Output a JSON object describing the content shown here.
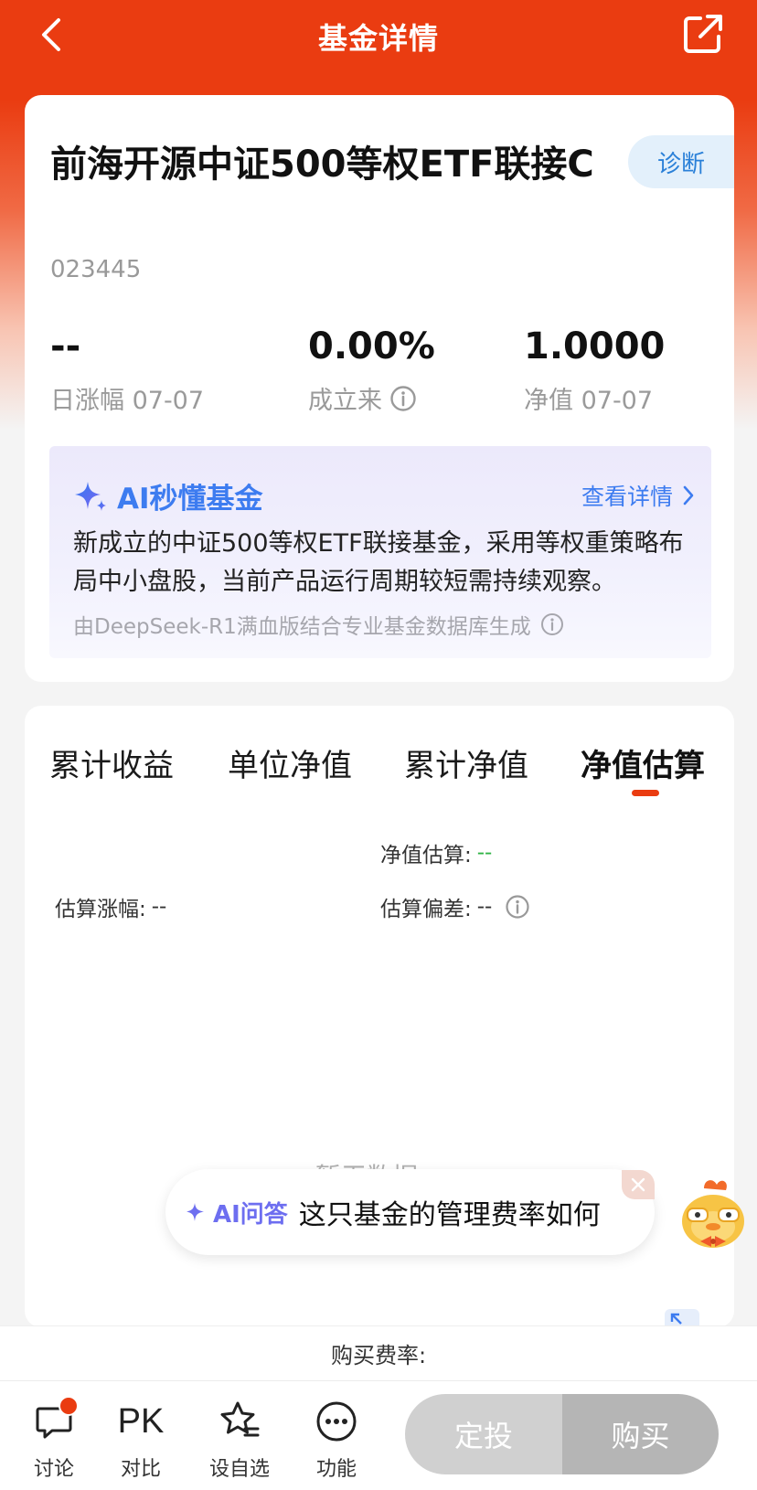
{
  "nav": {
    "title": "基金详情"
  },
  "fund": {
    "name": "前海开源中证500等权ETF联接C",
    "code": "023445",
    "diagnose_label": "诊断",
    "stats": [
      {
        "value": "--",
        "label": "日涨幅 07-07"
      },
      {
        "value": "0.00%",
        "label": "成立来"
      },
      {
        "value": "1.0000",
        "label": "净值 07-07"
      }
    ]
  },
  "ai_summary": {
    "title": "AI秒懂基金",
    "more_label": "查看详情",
    "description": "新成立的中证500等权ETF联接基金，采用等权重策略布局中小盘股，当前产品运行周期较短需持续观察。",
    "source": "由DeepSeek-R1满血版结合专业基金数据库生成"
  },
  "chart_tabs": {
    "tabs": [
      "累计收益",
      "单位净值",
      "累计净值",
      "净值估算"
    ],
    "active_index": 3
  },
  "estimate": {
    "nav_label": "净值估算:",
    "nav_value": "--",
    "change_label": "估算涨幅:",
    "change_value": "--",
    "deviation_label": "估算偏差:",
    "deviation_value": "--",
    "no_data": "暂无数据"
  },
  "ai_ask": {
    "tag": "AI问答",
    "question": "这只基金的管理费率如何"
  },
  "fee_bar": {
    "label": "购买费率:"
  },
  "bottom_bar": {
    "items": [
      {
        "label": "讨论",
        "icon": "chat-bubble-icon"
      },
      {
        "label": "对比",
        "icon": "pk-icon",
        "glyph": "PK"
      },
      {
        "label": "设自选",
        "icon": "star-list-icon"
      },
      {
        "label": "功能",
        "icon": "more-dots-icon"
      }
    ],
    "sip_label": "定投",
    "buy_label": "购买"
  },
  "colors": {
    "brand": "#ea3c11",
    "ai_blue": "#3d7cf0",
    "green": "#2fb344",
    "button_disabled": "#b5b5b5"
  }
}
